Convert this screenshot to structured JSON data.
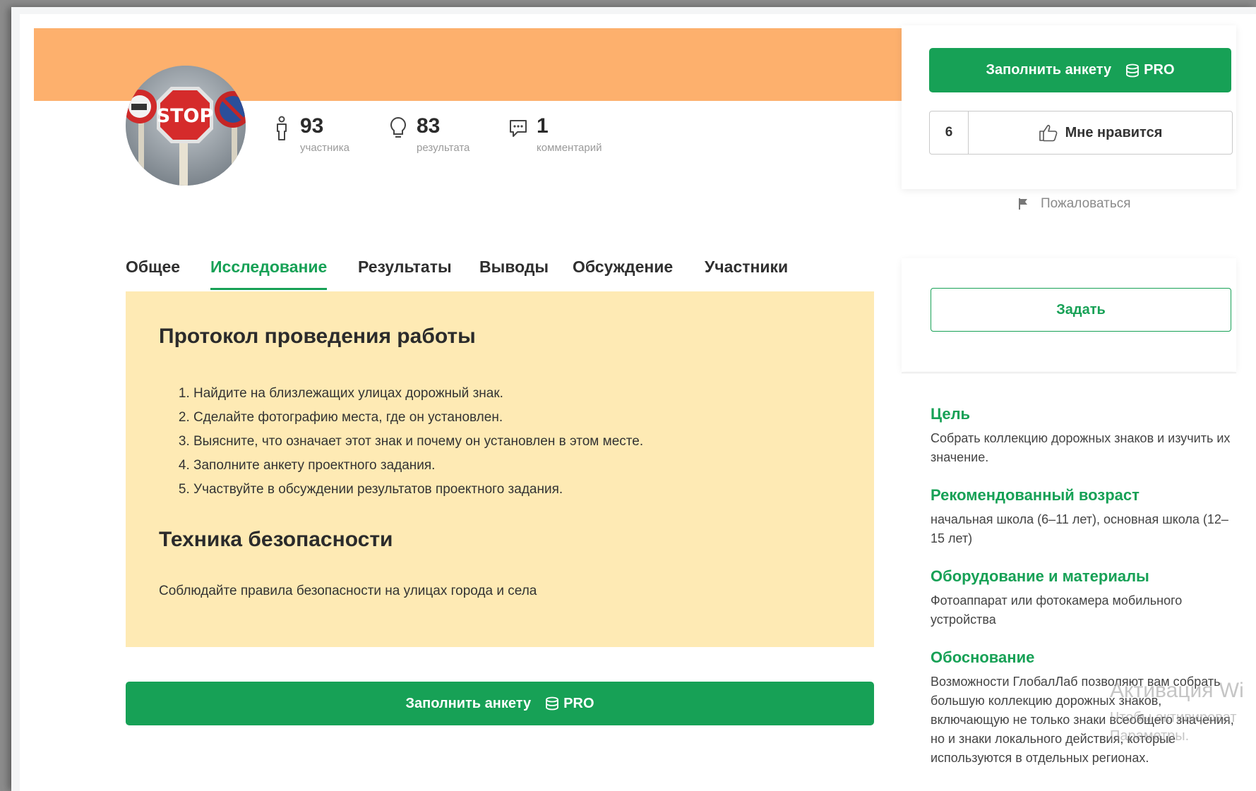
{
  "stats": [
    {
      "value": "93",
      "label": "участника",
      "icon": "person-icon"
    },
    {
      "value": "83",
      "label": "результата",
      "icon": "lightbulb-icon"
    },
    {
      "value": "1",
      "label": "комментарий",
      "icon": "comment-icon"
    }
  ],
  "tabs": [
    {
      "label": "Общее",
      "active": false
    },
    {
      "label": "Исследование",
      "active": true
    },
    {
      "label": "Результаты",
      "active": false
    },
    {
      "label": "Выводы",
      "active": false
    },
    {
      "label": "Обсуждение",
      "active": false
    },
    {
      "label": "Участники",
      "active": false
    }
  ],
  "content": {
    "protocol_title": "Протокол проведения работы",
    "steps": [
      "Найдите на близлежащих улицах дорожный знак.",
      "Сделайте фотографию места, где он установлен.",
      "Выясните, что означает этот знак и почему он установлен в этом месте.",
      "Заполните анкету проектного задания.",
      "Участвуйте в обсуждении результатов проектного задания."
    ],
    "safety_title": "Техника безопасности",
    "safety_text": "Соблюдайте правила безопасности на улицах города и села"
  },
  "fill_button": {
    "label": "Заполнить анкету",
    "pro": "PRO"
  },
  "sidebar": {
    "like_count": "6",
    "like_label": "Мне нравится",
    "report_label": "Пожаловаться",
    "ask_label": "Задать",
    "info": [
      {
        "title": "Цель",
        "text": "Собрать коллекцию дорожных знаков и изучить их значение."
      },
      {
        "title": "Рекомендованный возраст",
        "text": "начальная школа (6–11 лет), основная школа (12–15 лет)"
      },
      {
        "title": "Оборудование и материалы",
        "text": "Фотоаппарат или фотокамера мобильного устройства"
      },
      {
        "title": "Обоснование",
        "text": "Возможности ГлобалЛаб позволяют вам собрать большую коллекцию дорожных знаков, включающую не только знаки всеобщего значения, но и знаки локального действия, которые используются в отдельных регионах."
      }
    ]
  },
  "watermark": {
    "line1": "Активация Wi",
    "line2": "Чтобы активироват",
    "line3": "Параметры."
  },
  "colors": {
    "accent": "#17a156",
    "banner": "#fdb06d",
    "card": "#feeab4"
  }
}
